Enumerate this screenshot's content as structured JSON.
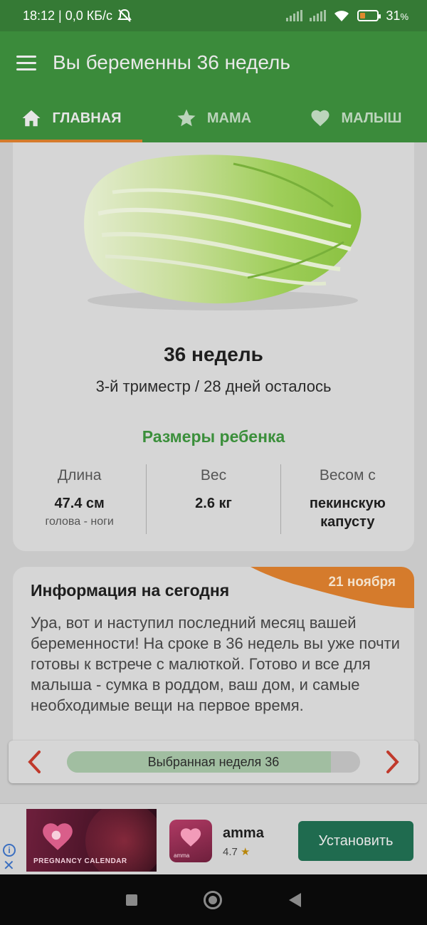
{
  "status_bar": {
    "time_speed": "18:12 | 0,0 КБ/с",
    "battery_percent": "31",
    "battery_suffix": "%",
    "battery_level": 0.31
  },
  "app_bar": {
    "title": "Вы беременны 36 недель"
  },
  "tabs": [
    {
      "label": "ГЛАВНАЯ",
      "icon": "home-icon",
      "active": true
    },
    {
      "label": "МАМА",
      "icon": "star-icon",
      "active": false
    },
    {
      "label": "МАЛЫШ",
      "icon": "heart-icon",
      "active": false
    }
  ],
  "week_card": {
    "image": "chinese-cabbage-image",
    "title": "36 недель",
    "subtitle": "3-й триместр / 28 дней осталось",
    "sizes_title": "Размеры ребенка",
    "stats": [
      {
        "label": "Длина",
        "value": "47.4 см",
        "sub": "голова - ноги"
      },
      {
        "label": "Вес",
        "value": "2.6 кг",
        "sub": ""
      },
      {
        "label": "Весом с",
        "value": "пекинскую капусту",
        "sub": ""
      }
    ]
  },
  "info_card": {
    "title": "Информация на сегодня",
    "date": "21 ноября",
    "text": "Ура, вот и наступил последний месяц вашей беременности! На сроке в 36 недель вы уже почти готовы к встрече с малюткой. Готово и все для малыша - сумка в роддом, ваш дом, и самые необходимые вещи на первое время."
  },
  "week_selector": {
    "label": "Выбранная неделя 36",
    "progress": 0.9
  },
  "ad": {
    "banner_text": "PREGNANCY CALENDAR",
    "app_icon_text": "amma",
    "app_name": "amma",
    "rating": "4.7",
    "install_label": "Установить"
  },
  "colors": {
    "primary": "#3b8b3b",
    "accent": "#d57b2c",
    "install": "#1f6b4f"
  }
}
